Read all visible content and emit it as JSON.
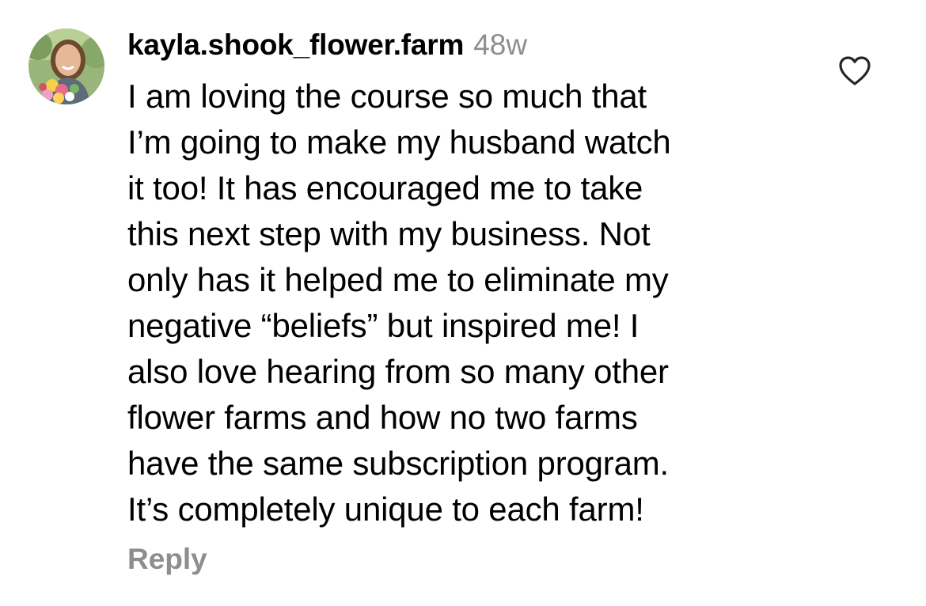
{
  "comment": {
    "username": "kayla.shook_flower.farm",
    "timestamp": "48w",
    "text_lines": [
      "I am loving the course so much that",
      "I’m going to make my husband watch",
      "it too! It has encouraged me to take",
      "this next step with my business. Not",
      "only has it helped me to eliminate my",
      "negative “beliefs” but inspired me! I",
      "also love hearing from so many other",
      "flower farms and how no two farms",
      "have the same subscription program.",
      "It’s completely unique to each farm!"
    ],
    "reply_label": "Reply",
    "like_icon": "heart-outline-icon",
    "avatar_icon": "profile-photo-avatar"
  },
  "colors": {
    "text": "#000000",
    "muted": "#8e8e8e",
    "background": "#ffffff",
    "icon_stroke": "#262626"
  }
}
